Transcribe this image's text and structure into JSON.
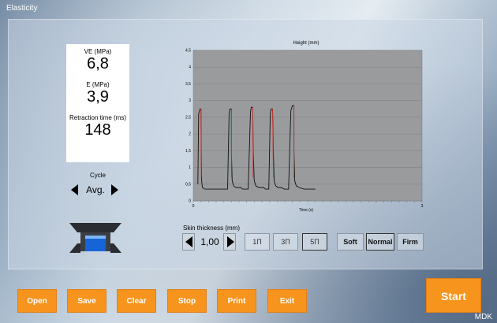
{
  "window": {
    "title": "Elasticity"
  },
  "metrics": [
    {
      "label": "VE (MPa)",
      "value": "6,8"
    },
    {
      "label": "E (MPa)",
      "value": "3,9"
    },
    {
      "label": "Retraction time (ms)",
      "value": "148"
    }
  ],
  "cycle": {
    "label": "Cycle",
    "value": "Avg."
  },
  "device": {
    "icon": "probe-device-icon",
    "accent": "#1565d8"
  },
  "chart": {
    "title": "Height (mm)",
    "xlabel": "Time (s)",
    "y_ticks": [
      "4,5",
      "4",
      "3,5",
      "3",
      "2,5",
      "2",
      "1,5",
      "1",
      "0,5",
      "0"
    ],
    "x_ticks": [
      "0",
      "3"
    ],
    "colors": {
      "plot_bg": "#999b9d",
      "line": "#111111",
      "highlight": "#e0342b"
    }
  },
  "chart_data": {
    "type": "line",
    "title": "Height (mm)",
    "xlabel": "Time (s)",
    "ylabel": "",
    "xlim": [
      0,
      3
    ],
    "ylim": [
      0,
      4.5
    ],
    "grid": true,
    "series": [
      {
        "x": [
          0.06,
          0.07,
          0.09,
          0.1,
          0.105,
          0.11,
          0.12,
          0.15,
          0.2,
          0.22,
          0.45,
          0.47,
          0.48,
          0.5,
          0.5,
          0.51,
          0.53,
          0.56,
          0.62,
          0.65,
          0.72,
          0.75,
          0.76,
          0.78,
          0.785,
          0.8,
          0.82,
          0.86,
          0.92,
          0.95,
          0.99,
          1.01,
          1.02,
          1.04,
          1.05,
          1.06,
          1.08,
          1.11,
          1.16,
          1.19,
          1.25,
          1.28,
          1.3,
          1.32,
          1.32,
          1.33,
          1.35,
          1.39,
          1.45,
          1.6
        ],
        "y": [
          0.5,
          2.6,
          2.75,
          2.75,
          1.5,
          0.6,
          0.4,
          0.35,
          0.35,
          0.35,
          0.35,
          2.6,
          2.75,
          2.75,
          1.5,
          0.6,
          0.45,
          0.4,
          0.4,
          0.35,
          0.35,
          2.65,
          2.8,
          2.8,
          1.5,
          0.6,
          0.45,
          0.4,
          0.4,
          0.35,
          0.35,
          2.6,
          2.75,
          2.75,
          1.5,
          0.6,
          0.45,
          0.4,
          0.4,
          0.35,
          0.35,
          2.7,
          2.85,
          2.85,
          1.5,
          0.6,
          0.45,
          0.4,
          0.35,
          0.35
        ]
      }
    ]
  },
  "skin": {
    "label": "Skin thickness (mm)",
    "value": "1,00"
  },
  "modes": [
    "1Π",
    "3Π",
    "5Π"
  ],
  "firmness": [
    "Soft",
    "Normal",
    "Firm"
  ],
  "actions": [
    "Open",
    "Save",
    "Clear",
    "Stop",
    "Print",
    "Exit"
  ],
  "start": "Start",
  "watermark": "MDK"
}
